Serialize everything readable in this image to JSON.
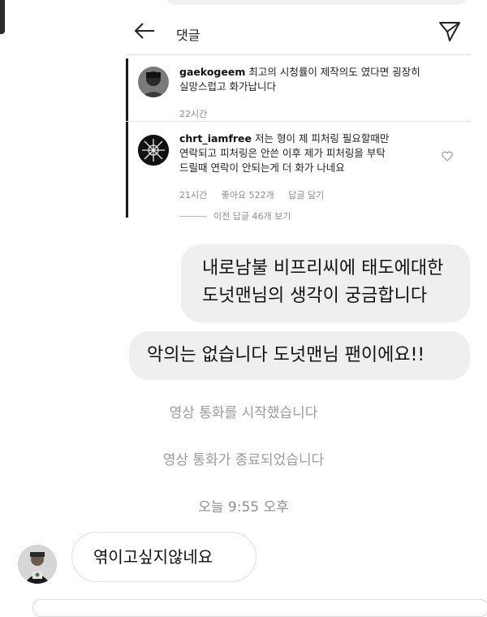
{
  "comments_card": {
    "title": "댓글",
    "comments": [
      {
        "username": "gaekogeem",
        "text_line1": "최고의 시청률이 제작의도 였다면 굉장히",
        "text_line2": "실망스럽고 화가납니다",
        "time": "22시간"
      },
      {
        "username": "chrt_iamfree",
        "text_line1": "저는 형이 제 피처링 필요할때만",
        "text_line2": "연락되고 피처링은 안쓴 이후 제가 피처링을 부탁",
        "text_line3": "드릴때 연락이 안되는게 더 화가 나네요",
        "time": "21시간",
        "likes": "좋아요 522개",
        "reply": "답글 달기"
      }
    ],
    "view_replies": "이전 답글 46개 보기"
  },
  "messages": {
    "outgoing_1_line1": "내로남불 비프리씨에 태도에대한",
    "outgoing_1_line2": "도넛맨님의 생각이 궁금합니다",
    "outgoing_2": "악의는 없습니다 도넛맨님 팬이에요!!",
    "system_1": "영상 통화를 시작했습니다",
    "system_2": "영상 통화가 종료되었습니다",
    "timestamp": "오늘 9:55 오후",
    "incoming_1": "엮이고싶지않네요"
  },
  "icons": {
    "back": "arrow-left-icon",
    "send": "paper-plane-icon",
    "like": "heart-icon"
  },
  "colors": {
    "bubble_gray": "#efefef",
    "meta_gray": "#8e8e8e",
    "system_gray": "#9a9a9a"
  }
}
